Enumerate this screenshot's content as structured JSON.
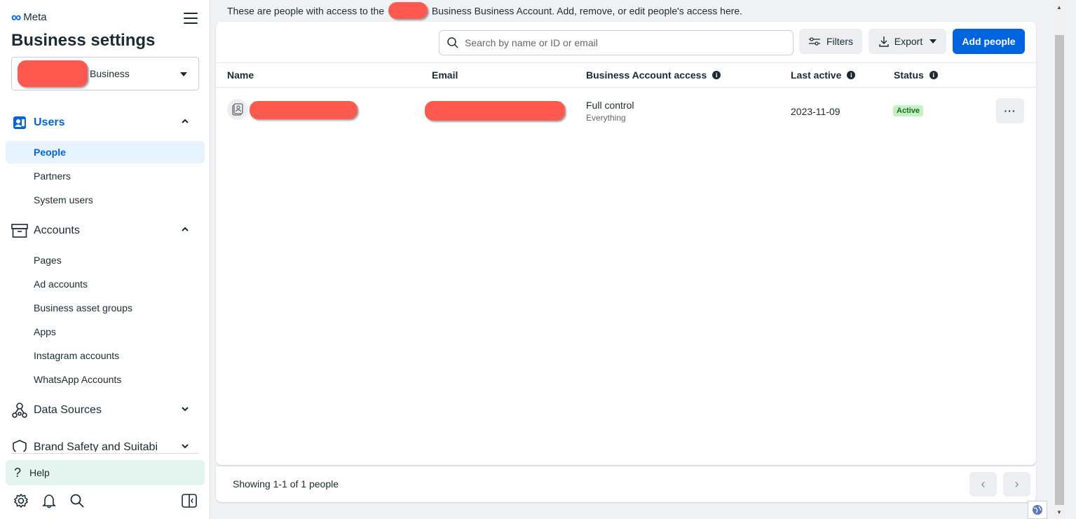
{
  "brand": {
    "logo_text": "Meta"
  },
  "sidebar": {
    "title": "Business settings",
    "business_name": "Business",
    "sections": {
      "users": {
        "label": "Users",
        "items": [
          "People",
          "Partners",
          "System users"
        ]
      },
      "accounts": {
        "label": "Accounts",
        "items": [
          "Pages",
          "Ad accounts",
          "Business asset groups",
          "Apps",
          "Instagram accounts",
          "WhatsApp Accounts"
        ]
      },
      "data_sources": {
        "label": "Data Sources"
      },
      "brand_safety": {
        "label": "Brand Safety and Suitabi"
      }
    },
    "help_label": "Help",
    "active_item": "People"
  },
  "main": {
    "subtitle_before": "These are people with access to the",
    "subtitle_after": "Business Business Account. Add, remove, or edit people's access here.",
    "search_placeholder": "Search by name or ID or email",
    "filters_label": "Filters",
    "export_label": "Export",
    "add_people_label": "Add people",
    "columns": [
      "Name",
      "Email",
      "Business Account access",
      "Last active",
      "Status"
    ],
    "rows": [
      {
        "access": "Full control",
        "access_detail": "Everything",
        "last_active": "2023-11-09",
        "status": "Active"
      }
    ],
    "footer_text": "Showing 1-1 of 1 people"
  },
  "colors": {
    "accent": "#0064e0",
    "active_bg": "#e7f3ff",
    "status_active": "#c5f0c5",
    "redaction": "#ff5a4f",
    "help_bg": "#e6f4ef"
  }
}
